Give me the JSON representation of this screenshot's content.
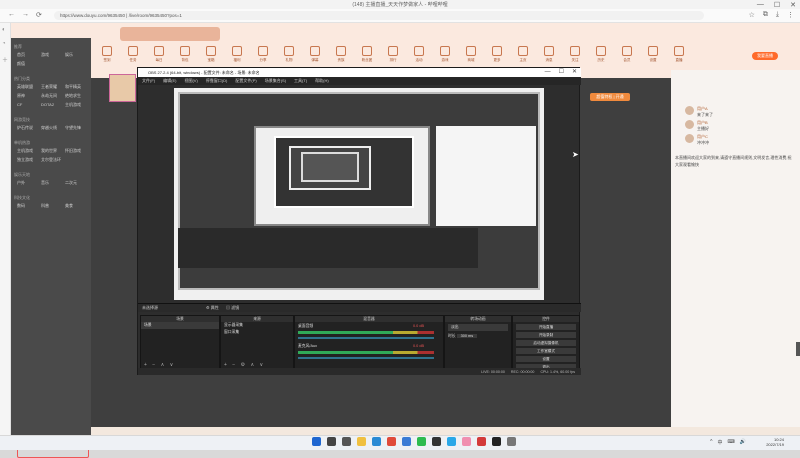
{
  "browser": {
    "window_title": "(148) 主播直播_天天作梦做家人 - 哔哩哔哩",
    "url": "https://www.douyu.com/9635450 | /live/room/9635450?pos=1",
    "nav": {
      "back": "←",
      "forward": "→",
      "reload": "⟳"
    },
    "window_controls": {
      "minimize": "—",
      "maximize": "☐",
      "close": "✕"
    },
    "tools": {
      "star": "☆",
      "extensions": "⧉",
      "download": "⤓",
      "menu": "⋮"
    }
  },
  "page": {
    "toolbar": [
      "签到",
      "任务",
      "每日",
      "背包",
      "宝箱",
      "福利",
      "分享",
      "礼物",
      "弹幕",
      "贵族",
      "粉丝团",
      "排行",
      "活动",
      "游戏",
      "商城",
      "更多",
      "主页",
      "消息",
      "关注",
      "历史",
      "会员",
      "设置",
      "直播"
    ],
    "live_button": "我要直播",
    "left_panel": {
      "sections": [
        {
          "header": "推荐",
          "items": [
            "首页",
            "游戏",
            "娱乐",
            "颜值"
          ]
        },
        {
          "header": "热门分类",
          "items": [
            "英雄联盟",
            "王者荣耀",
            "和平精英",
            "原神",
            "永劫无间",
            "绝地求生",
            "CF",
            "DOTA2",
            "主机游戏"
          ]
        },
        {
          "header": "网游竞技",
          "items": [
            "炉石传说",
            "穿越火线",
            "守望先锋"
          ]
        },
        {
          "header": "单机热游",
          "items": [
            "主机游戏",
            "我的世界",
            "怀旧游戏",
            "独立游戏",
            "艾尔登法环"
          ]
        },
        {
          "header": "娱乐天地",
          "items": [
            "户外",
            "音乐",
            "二次元"
          ]
        },
        {
          "header": "科技文化",
          "items": [
            "数码",
            "科普",
            "美食"
          ]
        }
      ]
    },
    "right_panel": {
      "tag": "超值特权 | 开通",
      "chat": [
        {
          "user": "用户A",
          "text": "来了来了"
        },
        {
          "user": "用户B",
          "text": "主播好"
        },
        {
          "user": "用户C",
          "text": "冲冲冲"
        }
      ],
      "announcement": "本直播间欢迎大家的到来,请遵守直播间规则,文明发言,理性消费,祝大家观看愉快"
    }
  },
  "obs": {
    "title": "OBS 27.2.4 (64-bit, windows) - 配置文件: 未命名 - 场景: 未命名",
    "menu": [
      "文件(F)",
      "编辑(E)",
      "视图(V)",
      "停靠窗口(D)",
      "配置文件(P)",
      "场景集合(S)",
      "工具(T)",
      "帮助(H)"
    ],
    "scene_bar": {
      "label": "未选择源",
      "properties": "⚙ 属性",
      "filters": "▤ 滤镜"
    },
    "docks": {
      "scenes": {
        "header": "场景",
        "items": [
          "场景"
        ]
      },
      "sources": {
        "header": "来源",
        "items": [
          "显示器采集",
          "窗口采集"
        ]
      },
      "mixer": {
        "header": "混音器",
        "channels": [
          {
            "name": "桌面音频",
            "db": "0.0 dB"
          },
          {
            "name": "麦克风/Aux",
            "db": "0.0 dB"
          }
        ]
      },
      "transitions": {
        "header": "转场动画",
        "type": "淡出",
        "duration_label": "时长",
        "duration": "300 ms"
      },
      "controls": {
        "header": "控件",
        "buttons": [
          "开始直播",
          "开始录制",
          "启动虚拟摄像机",
          "工作室模式",
          "设置",
          "退出"
        ]
      }
    },
    "status": {
      "live": "LIVE: 00:00:00",
      "rec": "REC: 00:00:00",
      "cpu": "CPU: 1.4%, 60.00 fps"
    }
  },
  "taskbar": {
    "time": "10:24",
    "date": "2022/7/19",
    "tray": [
      "^",
      "中",
      "⌨",
      "🔊"
    ],
    "icons": [
      {
        "name": "windows-icon",
        "color": "#1e66d0"
      },
      {
        "name": "search-icon",
        "color": "#444444"
      },
      {
        "name": "task-view-icon",
        "color": "#555555"
      },
      {
        "name": "explorer-icon",
        "color": "#f0c040"
      },
      {
        "name": "edge-icon",
        "color": "#2a8ad4"
      },
      {
        "name": "chrome-icon",
        "color": "#e04a3a"
      },
      {
        "name": "store-icon",
        "color": "#3a7bd5"
      },
      {
        "name": "wechat-icon",
        "color": "#2dbb4f"
      },
      {
        "name": "obs-icon",
        "color": "#333333"
      },
      {
        "name": "qq-icon",
        "color": "#2aa8e8"
      },
      {
        "name": "bilibili-icon",
        "color": "#f08fb0"
      },
      {
        "name": "music-icon",
        "color": "#d33a3a"
      },
      {
        "name": "terminal-icon",
        "color": "#222222"
      },
      {
        "name": "settings-icon",
        "color": "#777777"
      }
    ]
  }
}
